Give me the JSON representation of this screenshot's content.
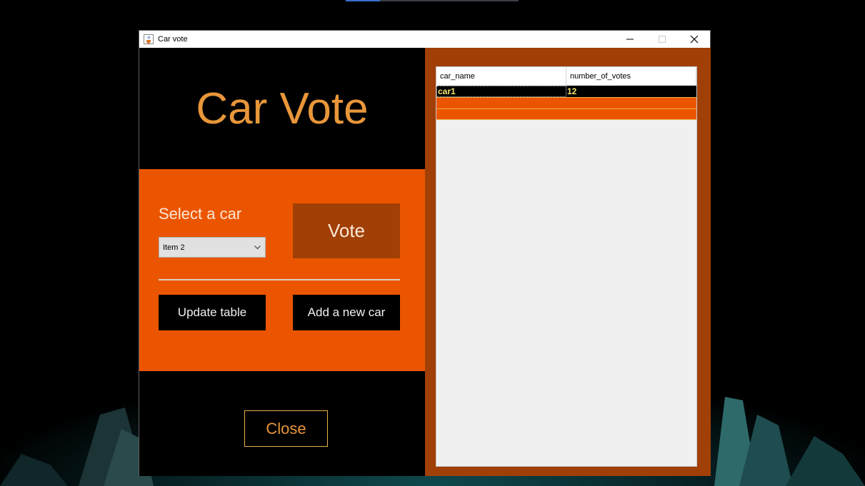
{
  "window": {
    "title": "Car vote"
  },
  "heading": "Car Vote",
  "form": {
    "select_label": "Select a car",
    "combo_value": "Item 2",
    "vote_label": "Vote",
    "update_label": "Update table",
    "add_label": "Add a new car",
    "close_label": "Close"
  },
  "table": {
    "columns": [
      "car_name",
      "number_of_votes"
    ],
    "rows": [
      [
        "car1",
        "12"
      ]
    ]
  },
  "colors": {
    "accent_orange": "#ec5500",
    "dark_orange": "#a03f06",
    "title_gold": "#e8963a",
    "selected_text": "#f5e470"
  },
  "icons": {
    "app": "java-cup-icon",
    "minimize": "minimize-icon",
    "maximize": "maximize-icon",
    "close": "close-icon",
    "dropdown": "chevron-down-icon"
  }
}
